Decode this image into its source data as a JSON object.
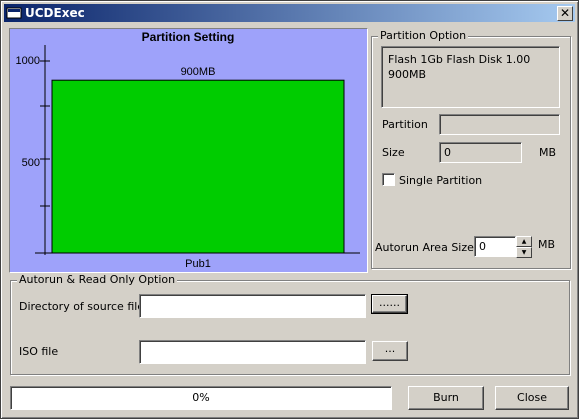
{
  "window": {
    "title": "UCDExec",
    "close_glyph": "✕"
  },
  "chart_data": {
    "type": "bar",
    "title": "Partition Setting",
    "categories": [
      "Pub1"
    ],
    "values": [
      900
    ],
    "data_labels": [
      "900MB"
    ],
    "yticks": [
      "1000",
      "500"
    ],
    "ylim": [
      0,
      1000
    ],
    "bar_color": "#00cc00",
    "background": "#9ea2fa"
  },
  "partition_option": {
    "legend": "Partition Option",
    "info_line1": "Flash    1Gb Flash Disk   1.00",
    "info_line2": "900MB",
    "partition_label": "Partition",
    "partition_value": "",
    "size_label": "Size",
    "size_value": "0",
    "size_unit": "MB",
    "single_partition_label": "Single Partition",
    "single_partition_checked": false,
    "autorun_label": "Autorun Area Size :",
    "autorun_value": "0",
    "autorun_unit": "MB"
  },
  "autorun_option": {
    "legend": "Autorun & Read Only Option",
    "dir_label": "Directory of source file",
    "dir_value": "",
    "browse1": "......",
    "iso_label": "ISO file",
    "iso_value": "",
    "browse2": "..."
  },
  "progress": {
    "text": "0%",
    "fraction": 0
  },
  "buttons": {
    "burn": "Burn",
    "close": "Close"
  }
}
